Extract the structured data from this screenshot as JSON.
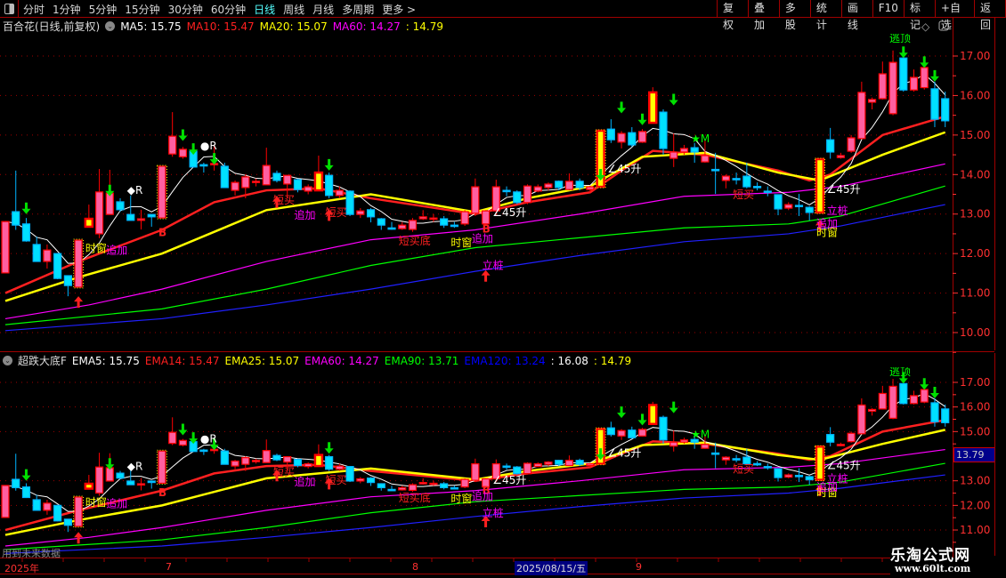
{
  "toolbar": {
    "periods": [
      "分时",
      "1分钟",
      "5分钟",
      "15分钟",
      "30分钟",
      "60分钟",
      "日线",
      "周线",
      "月线",
      "多周期",
      "更多 >"
    ],
    "active_period": "日线",
    "buttons": [
      "复权",
      "叠加",
      "多股",
      "统计",
      "画线",
      "F10",
      "标记",
      "+自选",
      "返回"
    ]
  },
  "main_legend": {
    "title": "百合花(日线,前复权)",
    "items": [
      {
        "label": "MA5: 15.75",
        "color": "#ffffff"
      },
      {
        "label": "MA10: 15.47",
        "color": "#ff2020"
      },
      {
        "label": "MA20: 15.07",
        "color": "#ffff00"
      },
      {
        "label": "MA60: 14.27",
        "color": "#ff00ff"
      },
      {
        "label": ": 14.79",
        "color": "#ffff00"
      }
    ]
  },
  "sub_legend": {
    "title": "超跌大底F",
    "items": [
      {
        "label": "EMA5: 15.75",
        "color": "#ffffff"
      },
      {
        "label": "EMA14: 15.47",
        "color": "#ff2020"
      },
      {
        "label": "EMA25: 15.07",
        "color": "#ffff00"
      },
      {
        "label": "EMA60: 14.27",
        "color": "#ff00ff"
      },
      {
        "label": "EMA90: 13.71",
        "color": "#00ff00"
      },
      {
        "label": "EMA120: 13.24",
        "color": "#0000ff"
      },
      {
        "label": ": 16.08",
        "color": "#ffffff"
      },
      {
        "label": ": 14.79",
        "color": "#ffff00"
      }
    ]
  },
  "main_axis": [
    "17.00",
    "16.00",
    "15.00",
    "14.00",
    "13.00",
    "12.00",
    "11.00",
    "10.00"
  ],
  "sub_axis": [
    "17.00",
    "16.00",
    "15.00",
    "13.00",
    "12.00",
    "11.00"
  ],
  "sub_price_box": "13.79",
  "time_axis": [
    {
      "label": "2025年",
      "highlight": false
    },
    {
      "label": "7",
      "highlight": false
    },
    {
      "label": "8",
      "highlight": false
    },
    {
      "label": "2025/08/15/五",
      "highlight": true
    },
    {
      "label": "9",
      "highlight": false
    }
  ],
  "future_data_note": "用到未来数据",
  "watermark": {
    "name": "乐淘公式网",
    "url": "www.60lt.com"
  },
  "colors": {
    "up": "#ff0000",
    "up_fill": "#ff5fa0",
    "down": "#00b4ff",
    "down_fill": "#00e0ff",
    "grid": "#a00000",
    "axis": "#ff3030"
  },
  "chart_data": {
    "type": "candlestick",
    "main_ylim": [
      9.7,
      17.5
    ],
    "sub_ylim": [
      10.7,
      17.8
    ],
    "candles": [
      [
        11.51,
        12.81,
        12.81,
        11.51
      ],
      [
        13.06,
        12.72,
        14.1,
        12.6
      ],
      [
        12.75,
        12.32,
        12.9,
        12.3
      ],
      [
        12.23,
        11.8,
        12.43,
        11.8
      ],
      [
        11.8,
        12.09,
        12.23,
        11.62
      ],
      [
        12.0,
        11.37,
        12.0,
        11.35
      ],
      [
        11.44,
        11.19,
        11.44,
        10.92
      ],
      [
        11.15,
        12.34,
        12.34,
        11.15
      ],
      [
        12.68,
        12.88,
        13.24,
        12.68
      ],
      [
        12.5,
        13.56,
        14.14,
        12.39
      ],
      [
        12.99,
        13.53,
        14.12,
        12.99
      ],
      [
        13.31,
        13.11,
        13.4,
        13.06
      ],
      [
        12.99,
        12.84,
        13.47,
        12.84
      ],
      [
        12.84,
        12.88,
        13.11,
        12.61
      ],
      [
        12.99,
        12.93,
        12.99,
        12.68
      ],
      [
        12.9,
        14.21,
        14.21,
        12.9
      ],
      [
        14.52,
        14.97,
        15.58,
        14.45
      ],
      [
        14.45,
        14.64,
        14.7,
        14.4
      ],
      [
        14.59,
        14.19,
        14.7,
        14.19
      ],
      [
        14.25,
        14.22,
        14.3,
        14.05
      ],
      [
        14.25,
        14.28,
        14.75,
        14.1
      ],
      [
        14.21,
        13.67,
        14.3,
        13.67
      ],
      [
        13.6,
        13.8,
        13.85,
        13.47
      ],
      [
        13.67,
        13.94,
        14.0,
        13.4
      ],
      [
        13.8,
        13.83,
        13.9,
        13.7
      ],
      [
        13.74,
        14.23,
        14.68,
        13.74
      ],
      [
        14.03,
        13.85,
        14.1,
        13.8
      ],
      [
        13.76,
        13.98,
        13.98,
        13.4
      ],
      [
        13.87,
        13.62,
        13.9,
        13.55
      ],
      [
        13.58,
        13.69,
        13.75,
        13.5
      ],
      [
        13.6,
        14.05,
        14.48,
        13.6
      ],
      [
        13.98,
        13.47,
        14.05,
        13.4
      ],
      [
        13.47,
        13.6,
        13.7,
        13.4
      ],
      [
        13.58,
        12.99,
        13.6,
        12.95
      ],
      [
        12.99,
        13.08,
        13.15,
        12.9
      ],
      [
        13.11,
        12.93,
        13.15,
        12.79
      ],
      [
        12.88,
        12.72,
        12.9,
        12.6
      ],
      [
        12.65,
        12.63,
        12.8,
        12.6
      ],
      [
        12.63,
        12.72,
        12.8,
        12.6
      ],
      [
        12.61,
        12.84,
        12.9,
        12.55
      ],
      [
        12.88,
        12.93,
        13.1,
        12.85
      ],
      [
        12.88,
        12.9,
        13.0,
        12.8
      ],
      [
        12.88,
        12.72,
        12.95,
        12.65
      ],
      [
        12.72,
        12.7,
        12.8,
        12.65
      ],
      [
        12.75,
        13.06,
        13.1,
        12.7
      ],
      [
        13.02,
        13.69,
        13.9,
        12.95
      ],
      [
        12.75,
        13.08,
        13.1,
        12.7
      ],
      [
        13.08,
        13.69,
        13.87,
        12.95
      ],
      [
        13.6,
        13.58,
        13.7,
        13.45
      ],
      [
        13.56,
        13.29,
        13.6,
        13.25
      ],
      [
        13.29,
        13.71,
        13.75,
        13.25
      ],
      [
        13.58,
        13.69,
        13.75,
        13.55
      ],
      [
        13.67,
        13.76,
        13.8,
        13.6
      ],
      [
        13.83,
        13.67,
        13.85,
        13.6
      ],
      [
        13.62,
        13.83,
        14.03,
        13.6
      ],
      [
        13.83,
        13.67,
        13.9,
        13.6
      ],
      [
        13.62,
        13.69,
        13.72,
        13.55
      ],
      [
        13.69,
        15.11,
        15.11,
        13.69
      ],
      [
        15.15,
        14.88,
        15.4,
        14.8
      ],
      [
        14.82,
        15.04,
        15.1,
        14.66
      ],
      [
        15.06,
        14.75,
        15.2,
        14.7
      ],
      [
        14.82,
        15.09,
        15.15,
        14.8
      ],
      [
        15.31,
        16.08,
        16.21,
        15.31
      ],
      [
        15.58,
        14.66,
        15.65,
        14.5
      ],
      [
        14.41,
        14.57,
        15.04,
        14.19
      ],
      [
        14.57,
        14.66,
        14.75,
        14.5
      ],
      [
        14.68,
        14.57,
        14.8,
        14.3
      ],
      [
        14.32,
        14.48,
        14.86,
        14.3
      ],
      [
        14.13,
        14.12,
        14.55,
        13.51
      ],
      [
        13.85,
        13.96,
        14.0,
        13.65
      ],
      [
        13.9,
        13.89,
        14.05,
        13.75
      ],
      [
        13.96,
        13.69,
        14.3,
        13.65
      ],
      [
        13.7,
        13.69,
        13.8,
        13.6
      ],
      [
        13.58,
        13.56,
        13.7,
        13.45
      ],
      [
        13.49,
        13.13,
        13.5,
        12.97
      ],
      [
        13.15,
        13.24,
        13.3,
        13.1
      ],
      [
        13.22,
        13.2,
        13.51,
        12.95
      ],
      [
        13.17,
        13.04,
        13.2,
        12.84
      ],
      [
        13.04,
        14.39,
        14.39,
        13.0
      ],
      [
        14.88,
        14.57,
        15.18,
        14.4
      ],
      [
        14.43,
        14.48,
        14.55,
        14.4
      ],
      [
        14.59,
        14.93,
        15.0,
        14.55
      ],
      [
        14.91,
        16.08,
        16.35,
        14.9
      ],
      [
        15.83,
        15.9,
        15.95,
        15.65
      ],
      [
        15.92,
        16.55,
        16.86,
        15.9
      ],
      [
        15.54,
        16.84,
        17.14,
        15.5
      ],
      [
        16.95,
        16.14,
        17.0,
        16.1
      ],
      [
        16.14,
        16.46,
        16.66,
        16.1
      ],
      [
        16.2,
        16.71,
        16.75,
        16.15
      ],
      [
        16.17,
        15.4,
        16.35,
        15.2
      ],
      [
        15.92,
        15.36,
        16.1,
        15.2
      ]
    ],
    "highlight_candles": [
      7,
      15,
      57,
      78
    ],
    "yellow_candles": [
      8,
      30,
      57,
      62,
      78
    ],
    "lines": [
      {
        "name": "MA10",
        "color": "#ff2020",
        "width": 2.5,
        "points": [
          [
            0,
            11.0
          ],
          [
            7,
            11.8
          ],
          [
            15,
            12.6
          ],
          [
            20,
            13.3
          ],
          [
            25,
            13.6
          ],
          [
            30,
            13.65
          ],
          [
            35,
            13.4
          ],
          [
            45,
            13.0
          ],
          [
            50,
            13.3
          ],
          [
            56,
            13.55
          ],
          [
            59,
            14.1
          ],
          [
            62,
            14.6
          ],
          [
            67,
            14.5
          ],
          [
            74,
            14.1
          ],
          [
            77,
            13.85
          ],
          [
            79,
            14.0
          ],
          [
            84,
            15.0
          ],
          [
            90,
            15.47
          ]
        ]
      },
      {
        "name": "MA20",
        "color": "#ffff00",
        "width": 2.5,
        "points": [
          [
            0,
            10.8
          ],
          [
            7,
            11.4
          ],
          [
            15,
            12.0
          ],
          [
            25,
            13.1
          ],
          [
            35,
            13.5
          ],
          [
            45,
            13.05
          ],
          [
            50,
            13.4
          ],
          [
            56,
            13.7
          ],
          [
            61,
            14.45
          ],
          [
            67,
            14.55
          ],
          [
            74,
            14.05
          ],
          [
            78,
            13.85
          ],
          [
            84,
            14.5
          ],
          [
            90,
            15.07
          ]
        ]
      },
      {
        "name": "MA60",
        "color": "#ff00ff",
        "width": 1.2,
        "points": [
          [
            0,
            10.35
          ],
          [
            8,
            10.7
          ],
          [
            15,
            11.1
          ],
          [
            25,
            11.8
          ],
          [
            35,
            12.35
          ],
          [
            45,
            12.6
          ],
          [
            55,
            13.0
          ],
          [
            65,
            13.45
          ],
          [
            75,
            13.55
          ],
          [
            80,
            13.7
          ],
          [
            90,
            14.27
          ]
        ]
      },
      {
        "name": "EMA90",
        "color": "#00ff00",
        "width": 1.2,
        "points": [
          [
            0,
            10.2
          ],
          [
            15,
            10.6
          ],
          [
            25,
            11.1
          ],
          [
            35,
            11.7
          ],
          [
            45,
            12.15
          ],
          [
            55,
            12.4
          ],
          [
            65,
            12.65
          ],
          [
            75,
            12.75
          ],
          [
            80,
            12.95
          ],
          [
            90,
            13.71
          ]
        ]
      },
      {
        "name": "EMA120",
        "color": "#2020ff",
        "width": 1.2,
        "points": [
          [
            0,
            10.05
          ],
          [
            15,
            10.35
          ],
          [
            25,
            10.7
          ],
          [
            35,
            11.1
          ],
          [
            45,
            11.55
          ],
          [
            55,
            11.95
          ],
          [
            65,
            12.3
          ],
          [
            75,
            12.5
          ],
          [
            80,
            12.7
          ],
          [
            90,
            13.24
          ]
        ]
      }
    ],
    "annotations": [
      {
        "text": "B",
        "i": 15,
        "p": 12.55,
        "color": "#ff2020"
      },
      {
        "text": "B",
        "i": 46,
        "p": 12.65,
        "color": "#ff2020"
      },
      {
        "text": "◆R",
        "i": 12,
        "p": 13.62,
        "color": "#ffffff"
      },
      {
        "text": "●R",
        "i": 19,
        "p": 14.75,
        "color": "#ffffff"
      },
      {
        "text": "时窗",
        "i": 8,
        "p": 12.15,
        "color": "#ffff00"
      },
      {
        "text": "时窗",
        "i": 43,
        "p": 12.3,
        "color": "#ffff00"
      },
      {
        "text": "时窗",
        "i": 78,
        "p": 12.55,
        "color": "#ffff00"
      },
      {
        "text": "追加",
        "i": 10,
        "p": 12.1,
        "color": "#ff00ff"
      },
      {
        "text": "追加",
        "i": 28,
        "p": 12.99,
        "color": "#ff00ff"
      },
      {
        "text": "追加",
        "i": 45,
        "p": 12.4,
        "color": "#ff00ff"
      },
      {
        "text": "追加",
        "i": 78,
        "p": 12.78,
        "color": "#ff00ff"
      },
      {
        "text": "短买",
        "i": 26,
        "p": 13.38,
        "color": "#ff2020"
      },
      {
        "text": "短买",
        "i": 31,
        "p": 13.06,
        "color": "#ff2020"
      },
      {
        "text": "短买",
        "i": 70,
        "p": 13.51,
        "color": "#ff2020"
      },
      {
        "text": "短买底",
        "i": 38,
        "p": 12.34,
        "color": "#ff2020"
      },
      {
        "text": "立桩",
        "i": 46,
        "p": 11.72,
        "color": "#ff00ff"
      },
      {
        "text": "立桩",
        "i": 79,
        "p": 13.11,
        "color": "#ff00ff"
      },
      {
        "text": "∠45升",
        "i": 47,
        "p": 13.06,
        "color": "#ffffff"
      },
      {
        "text": "∠45升",
        "i": 58,
        "p": 14.16,
        "color": "#ffffff"
      },
      {
        "text": "∠45升",
        "i": 79,
        "p": 13.65,
        "color": "#ffffff"
      },
      {
        "text": "★M",
        "i": 66,
        "p": 14.93,
        "color": "#00ff00"
      },
      {
        "text": "逃顶",
        "i": 85,
        "p": 17.47,
        "color": "#00ff00"
      }
    ],
    "up_arrows": [
      [
        7,
        10.92
      ],
      [
        26,
        13.45
      ],
      [
        31,
        13.12
      ],
      [
        46,
        11.58
      ],
      [
        78,
        12.85
      ]
    ],
    "down_arrows": [
      [
        2,
        13.0
      ],
      [
        10,
        13.45
      ],
      [
        17,
        14.85
      ],
      [
        18,
        14.5
      ],
      [
        20,
        14.25
      ],
      [
        31,
        14.1
      ],
      [
        57,
        13.85
      ],
      [
        59,
        15.55
      ],
      [
        61,
        15.25
      ],
      [
        64,
        15.75
      ],
      [
        86,
        16.95
      ],
      [
        88,
        16.7
      ],
      [
        89,
        16.35
      ]
    ]
  }
}
